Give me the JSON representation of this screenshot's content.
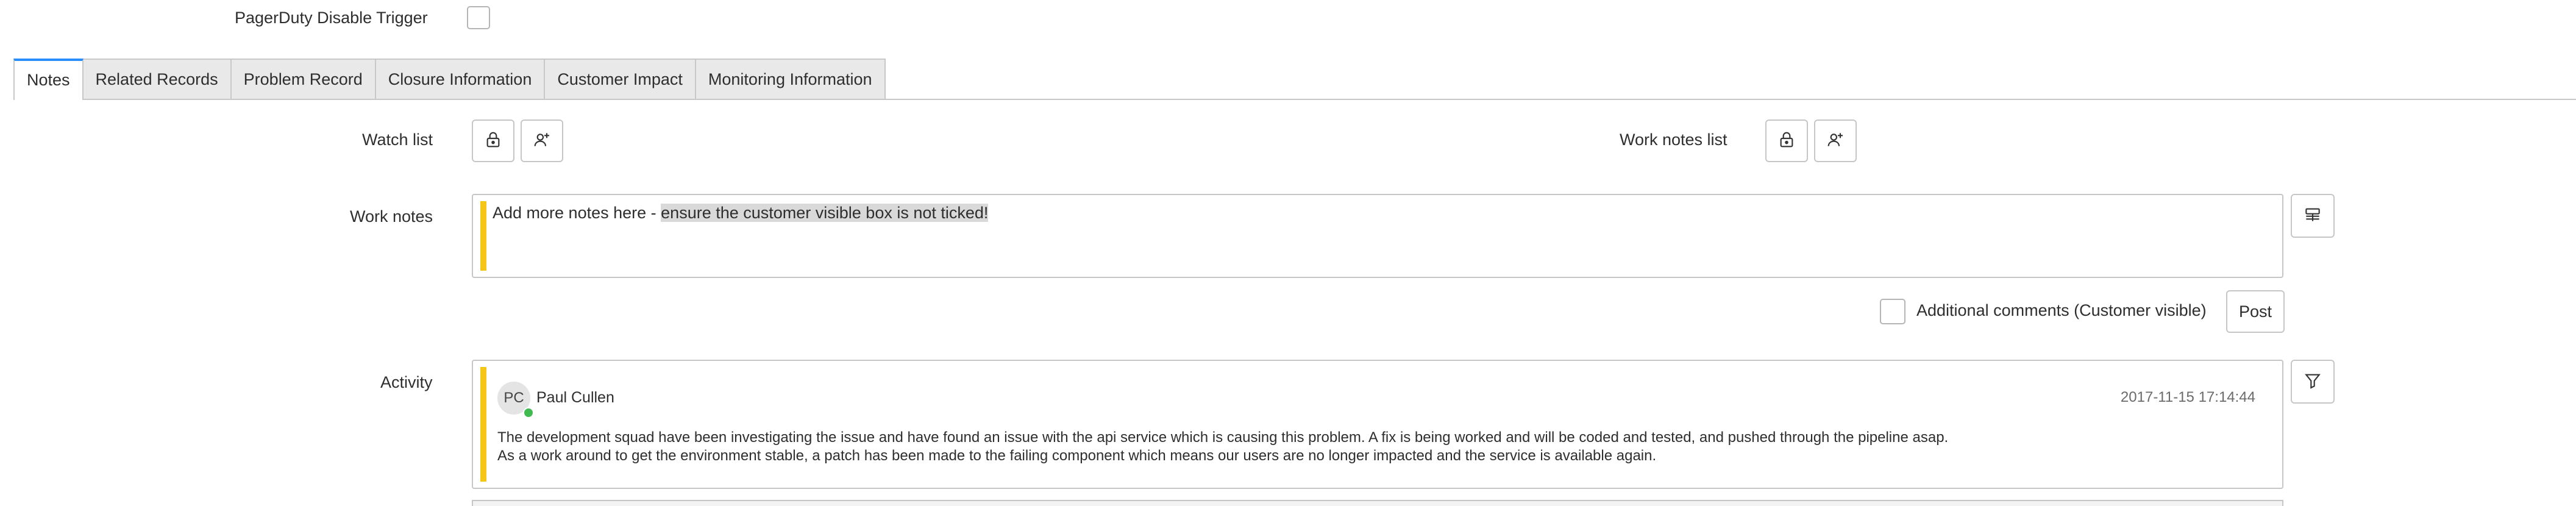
{
  "pagerduty": {
    "label": "PagerDuty Disable Trigger",
    "checked": false
  },
  "tabs": [
    {
      "label": "Notes",
      "active": true
    },
    {
      "label": "Related Records",
      "active": false
    },
    {
      "label": "Problem Record",
      "active": false
    },
    {
      "label": "Closure Information",
      "active": false
    },
    {
      "label": "Customer Impact",
      "active": false
    },
    {
      "label": "Monitoring Information",
      "active": false
    }
  ],
  "watch_list": {
    "label": "Watch list",
    "lock_icon": "lock-icon",
    "add_icon": "add-user-icon"
  },
  "work_notes_list": {
    "label": "Work notes list",
    "lock_icon": "lock-icon",
    "add_icon": "add-user-icon"
  },
  "work_notes": {
    "label": "Work notes",
    "value_plain": "Add more notes here - ",
    "value_selected": "ensure the customer visible box is not ticked!",
    "side_icon": "template-icon"
  },
  "additional_comments": {
    "label": "Additional comments (Customer visible)",
    "checked": false
  },
  "post_button": {
    "label": "Post"
  },
  "activity": {
    "label": "Activity",
    "filter_icon": "filter-icon",
    "entries": [
      {
        "initials": "PC",
        "author": "Paul Cullen",
        "timestamp": "2017-11-15 17:14:44",
        "lines": [
          "The development squad have been investigating the issue and have found an issue with the api service which is causing this problem. A fix is being worked and will be coded and tested, and pushed through the pipeline asap.",
          "As a work around to get the environment stable, a patch has been made to the failing component which means our users are no longer impacted and the service is available again."
        ]
      }
    ]
  },
  "colors": {
    "active_tab_accent": "#278efc",
    "work_notes_bar": "#f5c518",
    "presence_online": "#3fb950"
  }
}
